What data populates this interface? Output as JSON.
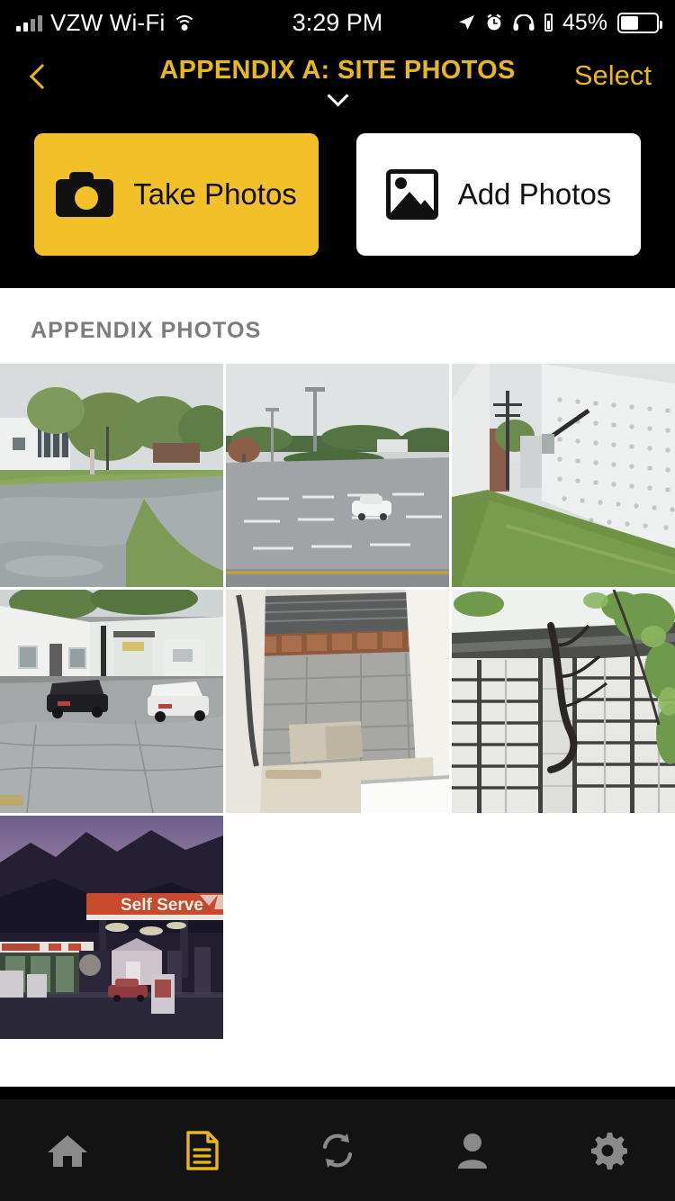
{
  "status_bar": {
    "carrier": "VZW Wi-Fi",
    "time": "3:29 PM",
    "battery_percent": "45%",
    "icons": [
      "signal-bars-icon",
      "wifi-icon",
      "location-arrow-icon",
      "alarm-clock-icon",
      "headphones-icon",
      "headphone-battery-icon",
      "battery-icon"
    ]
  },
  "nav": {
    "back_label": "back-chevron",
    "title": "APPENDIX A: SITE PHOTOS",
    "dropdown_icon": "chevron-down-icon",
    "select_label": "Select",
    "accent_color": "#e8b61d"
  },
  "actions": {
    "take_photos": {
      "label": "Take Photos",
      "icon": "camera-icon",
      "bg": "#f2c029"
    },
    "add_photos": {
      "label": "Add Photos",
      "icon": "image-icon",
      "bg": "#ffffff"
    }
  },
  "content": {
    "section_title": "APPENDIX PHOTOS",
    "photos": [
      {
        "name": "photo-building-lawn-wet-pavement",
        "alt": "White building with trees, grass and wet pavement"
      },
      {
        "name": "photo-parking-lot-white-car",
        "alt": "Empty parking lot with a white car and light poles"
      },
      {
        "name": "photo-block-wall-grass-strip",
        "alt": "White block wall beside a grass strip with utility pole"
      },
      {
        "name": "photo-loading-dock-cars",
        "alt": "Loading dock area with black and white cars on wet asphalt"
      },
      {
        "name": "photo-overhead-door-block-wall",
        "alt": "Open overhead door showing interior block wall"
      },
      {
        "name": "photo-brick-wall-tree-branch",
        "alt": "Brick and glass block wall with bare tree branch"
      },
      {
        "name": "photo-gas-station-self-serve",
        "alt": "Gas station at dusk with Self Serve canopy sign and mountains"
      }
    ],
    "photo_count": 7,
    "sign_text": "Self Serve"
  },
  "tabbar": {
    "items": [
      {
        "name": "tab-home",
        "icon": "home-icon",
        "active": false
      },
      {
        "name": "tab-reports",
        "icon": "document-icon",
        "active": true
      },
      {
        "name": "tab-sync",
        "icon": "sync-icon",
        "active": false
      },
      {
        "name": "tab-profile",
        "icon": "person-icon",
        "active": false
      },
      {
        "name": "tab-settings",
        "icon": "gear-icon",
        "active": false
      }
    ],
    "active_color": "#e8b61d",
    "inactive_color": "#8a8a8a",
    "background": "#131313"
  }
}
